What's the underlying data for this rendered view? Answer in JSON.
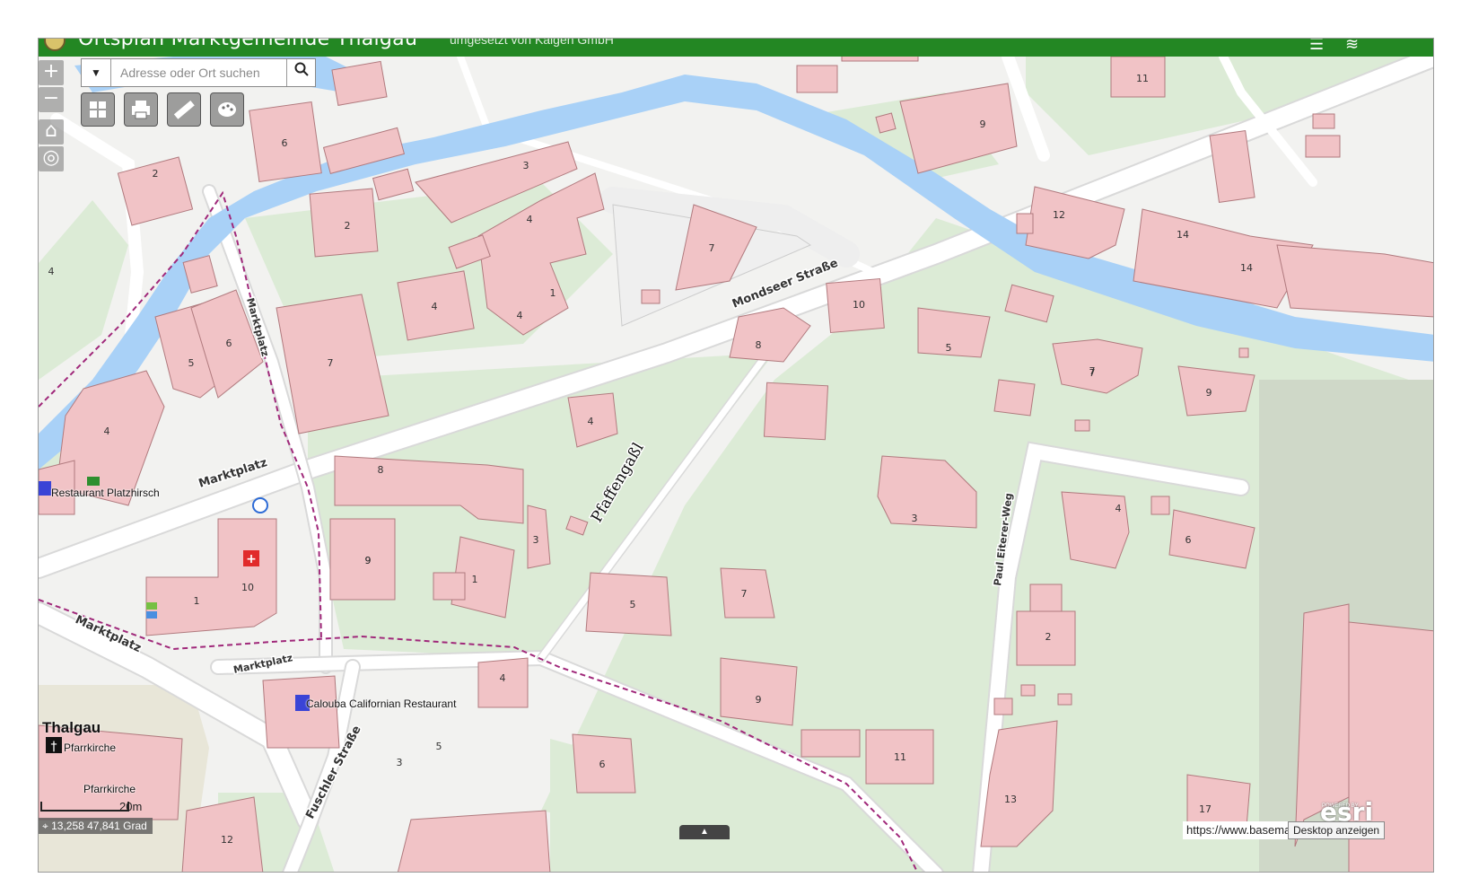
{
  "header": {
    "title": "Ortsplan Marktgemeinde Thalgau",
    "subtitle": "umgesetzt von Kaigen GmbH"
  },
  "search": {
    "placeholder": "Adresse oder Ort suchen"
  },
  "toolbar": {
    "buttons": [
      "basemap-gallery-icon",
      "print-icon",
      "measure-icon",
      "palette-icon"
    ]
  },
  "zoom": {
    "in": "+",
    "out": "−"
  },
  "streets": {
    "mondseer": "Mondseer Straße",
    "marktplatz": "Marktplatz",
    "pfaffengassl": "Pfaffengaßl",
    "paul_eiterer": "Paul Eiterer-Weg",
    "fuschler": "Fuschler Straße"
  },
  "pois": {
    "platzhirsch": "Restaurant Platzhirsch",
    "calouba": "Calouba Californian Restaurant",
    "place": "Thalgau",
    "pfarrkirche": "Pfarrkirche"
  },
  "house_numbers": [
    "11",
    "9",
    "6",
    "2",
    "3",
    "4",
    "2",
    "7",
    "14",
    "12",
    "14",
    "4",
    "7",
    "10",
    "8",
    "5",
    "1",
    "4",
    "4",
    "5",
    "6",
    "7",
    "4",
    "9",
    "7",
    "9",
    "8",
    "4",
    "3",
    "4",
    "6",
    "9",
    "3",
    "1",
    "10",
    "1",
    "5",
    "7",
    "2",
    "4",
    "9",
    "11",
    "6",
    "5",
    "3",
    "13",
    "17",
    "12"
  ],
  "status": {
    "coords": "13,258 47,841 Grad",
    "scale": "20m",
    "attribution": "https://www.basemap.at",
    "desktop": "Desktop anzeigen",
    "esri": "esri",
    "powered": "POWERED BY"
  },
  "colors": {
    "header": "#238723",
    "building": "#f1c3c6",
    "building_stroke": "#b07a7e",
    "water": "#a9d1f7",
    "green": "#dcebd6",
    "road": "#ffffff",
    "boundary": "#a0287a"
  }
}
